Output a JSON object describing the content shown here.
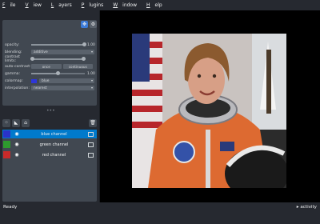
{
  "menu": [
    {
      "pre": "",
      "ul": "F",
      "post": "ile"
    },
    {
      "pre": "",
      "ul": "V",
      "post": "iew"
    },
    {
      "pre": "",
      "ul": "L",
      "post": "ayers"
    },
    {
      "pre": "",
      "ul": "P",
      "post": "lugins"
    },
    {
      "pre": "",
      "ul": "W",
      "post": "indow"
    },
    {
      "pre": "",
      "ul": "H",
      "post": "elp"
    }
  ],
  "controls": {
    "opacity": {
      "label": "opacity:",
      "value": "1.00",
      "level": 1.0
    },
    "blending": {
      "label": "blending:",
      "value": "additive"
    },
    "contrast_limits": {
      "label": "contrast limits:"
    },
    "auto_contrast": {
      "label": "auto-contrast:",
      "once": "once",
      "continuous": "continuous"
    },
    "gamma": {
      "label": "gamma:",
      "value": "1.00",
      "level": 0.5
    },
    "colormap": {
      "label": "colormap:",
      "value": "blue",
      "color": "#2e36d8"
    },
    "interpolation": {
      "label": "interpolation:",
      "value": "nearest"
    }
  },
  "layers": [
    {
      "name": "blue channel",
      "selected": true,
      "color": "#2a33c8"
    },
    {
      "name": "green channel",
      "selected": false,
      "color": "#2e9a2e"
    },
    {
      "name": "red channel",
      "selected": false,
      "color": "#c82a2a"
    }
  ],
  "status": {
    "left": "Ready",
    "right": "▸ activity"
  },
  "colors": {
    "accent": "#007acc",
    "panel": "#414851",
    "background": "#262930"
  }
}
